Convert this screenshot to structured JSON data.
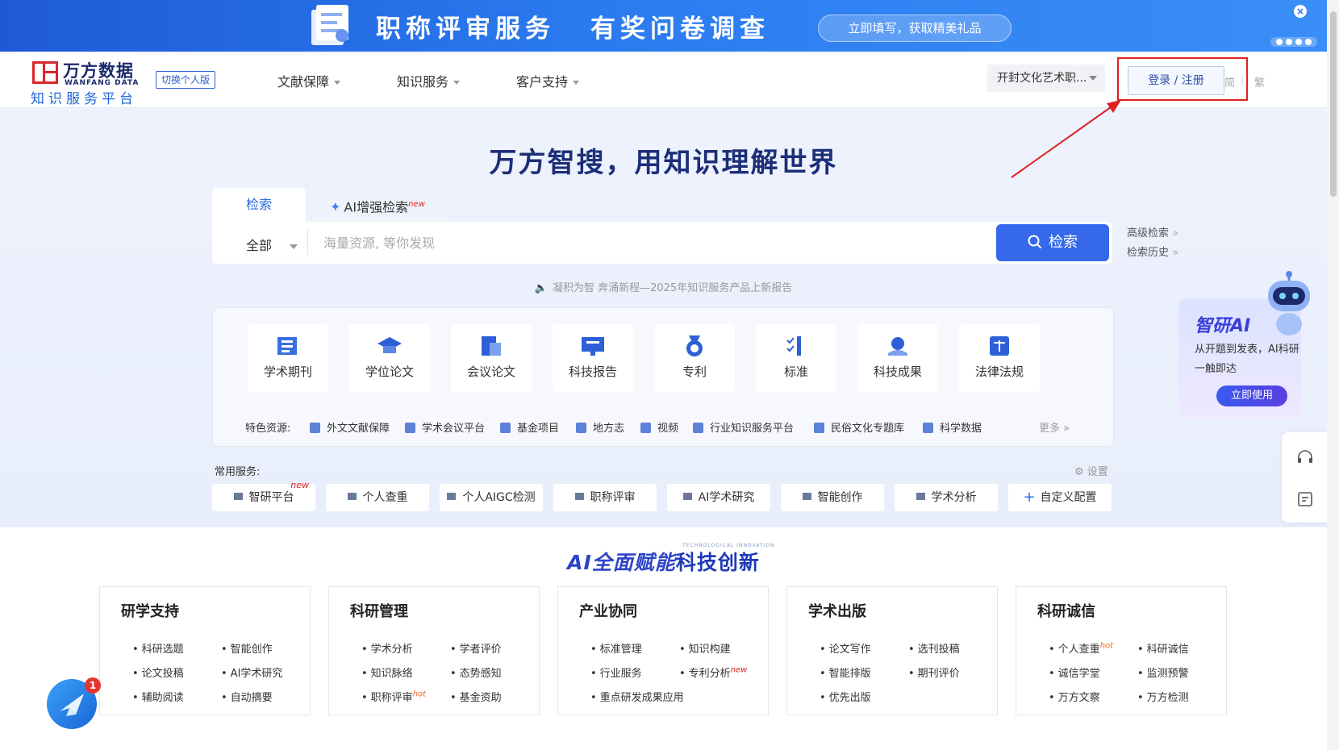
{
  "banner": {
    "text1": "职称评审服务",
    "text2": "有奖问卷调查",
    "cta": "立即填写，获取精美礼品",
    "close": "×"
  },
  "header": {
    "logo_cn": "万方数据",
    "logo_en": "WANFANG DATA",
    "logo_sub": "知识服务平台",
    "switch": "切换个人版",
    "nav": [
      "文献保障",
      "知识服务",
      "客户支持"
    ],
    "org": "开封文化艺术职...",
    "login": "登录 / 注册",
    "lang_simplified": "简",
    "lang_traditional": "繁"
  },
  "hero": {
    "title": "万方智搜，用知识理解世界",
    "tab_search": "检索",
    "tab_ai": "AI增强检索",
    "tab_ai_badge": "new",
    "scope": "全部",
    "placeholder": "海量资源, 等你发现",
    "search_btn": "检索",
    "advanced": "高级检索",
    "history": "检索历史",
    "notice": "凝积为智 奔涌新程—2025年知识服务产品上新报告"
  },
  "categories": [
    "学术期刊",
    "学位论文",
    "会议论文",
    "科技报告",
    "专利",
    "标准",
    "科技成果",
    "法律法规"
  ],
  "featured": {
    "label": "特色资源:",
    "items": [
      "外文文献保障",
      "学术会议平台",
      "基金项目",
      "地方志",
      "视频",
      "行业知识服务平台",
      "民俗文化专题库",
      "科学数据"
    ],
    "more": "更多"
  },
  "services": {
    "title": "常用服务:",
    "settings": "设置",
    "items": [
      "智研平台",
      "个人查重",
      "个人AIGC检测",
      "职称评审",
      "AI学术研究",
      "智能创作",
      "学术分析",
      "自定义配置"
    ],
    "badge_new": "new"
  },
  "ai_card": {
    "title": "智研AI",
    "desc": "从开题到发表，AI科研一触即达",
    "btn": "立即使用"
  },
  "bottom": {
    "title_a": "AI全面赋能",
    "title_b": "科技创新",
    "title_small": "TECHNOLOGICAL INNOVATION",
    "cards": [
      {
        "title": "研学支持",
        "items": [
          "科研选题",
          "智能创作",
          "论文投稿",
          "AI学术研究",
          "辅助阅读",
          "自动摘要"
        ]
      },
      {
        "title": "科研管理",
        "items": [
          "学术分析",
          "学者评价",
          "知识脉络",
          "态势感知",
          "职称评审",
          "基金资助"
        ]
      },
      {
        "title": "产业协同",
        "items": [
          "标准管理",
          "知识构建",
          "行业服务",
          "专利分析",
          "重点研发成果应用"
        ]
      },
      {
        "title": "学术出版",
        "items": [
          "论文写作",
          "选刊投稿",
          "智能排版",
          "期刊评价",
          "优先出版"
        ]
      },
      {
        "title": "科研诚信",
        "items": [
          "个人查重",
          "科研诚信",
          "诚信学堂",
          "监测预警",
          "万方文察",
          "万方检测"
        ]
      }
    ],
    "hot": "hot",
    "new": "new"
  },
  "chat": {
    "badge": "1"
  }
}
